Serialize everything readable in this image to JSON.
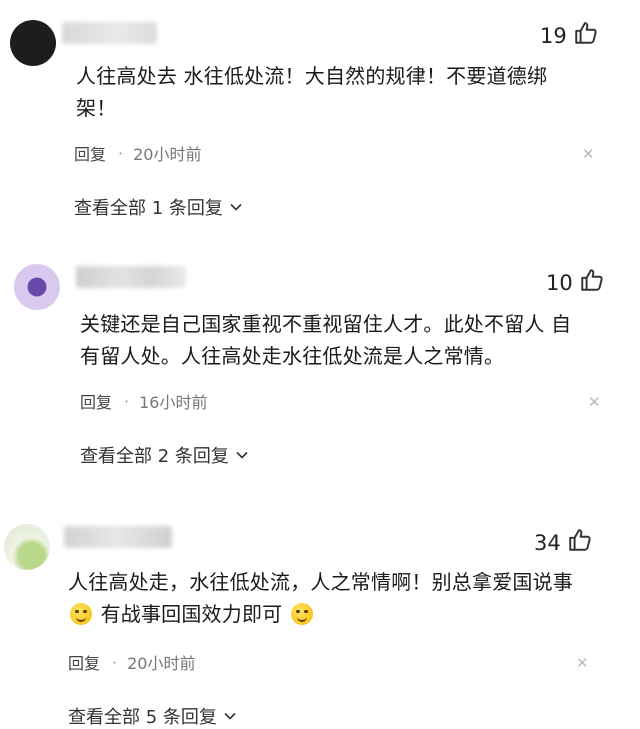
{
  "comments": [
    {
      "likes": "19",
      "text_line1": "人往高处去 水往低处流！大自然的规律！不要道德绑",
      "text_line2": "架！",
      "reply_label": "回复",
      "separator": "·",
      "time": "20小时前",
      "view_replies": "查看全部 1 条回复"
    },
    {
      "likes": "10",
      "text_line1": "关键还是自己国家重视不重视留住人才。此处不留人 自",
      "text_line2": "有留人处。人往高处走水往低处流是人之常情。",
      "reply_label": "回复",
      "separator": "·",
      "time": "16小时前",
      "view_replies": "查看全部 2 条回复"
    },
    {
      "likes": "34",
      "text_line1": "人往高处走，水往低处流，人之常情啊！别总拿爱国说事",
      "text_line2": "有战事回国效力即可",
      "reply_label": "回复",
      "separator": "·",
      "time": "20小时前",
      "view_replies": "查看全部 5 条回复"
    }
  ],
  "icons": {
    "like": "thumbs-up-icon",
    "close": "close-icon",
    "chevron": "chevron-down-icon"
  }
}
